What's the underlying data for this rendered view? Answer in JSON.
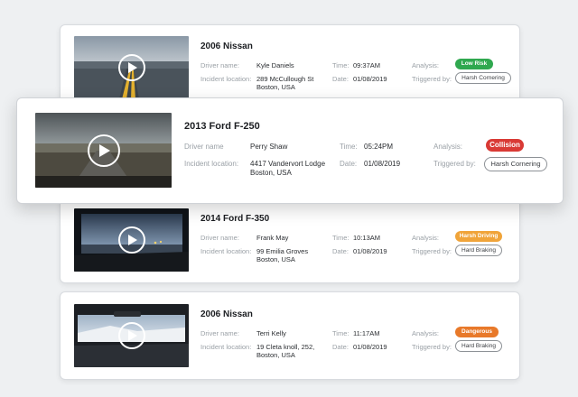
{
  "labels": {
    "driver": "Driver name:",
    "driver_featured": "Driver name",
    "location": "Incident location:",
    "time": "Time:",
    "date": "Date:",
    "analysis": "Analysis:",
    "triggered": "Triggered by:"
  },
  "incidents": [
    {
      "vehicle": "2006 Nissan",
      "driver": "Kyle Daniels",
      "location": "289 McCullough St Boston, USA",
      "time": "09:37AM",
      "date": "01/08/2019",
      "analysis": "Low Risk",
      "analysis_color": "#2fa84f",
      "trigger": "Harsh Cornering"
    },
    {
      "vehicle": "2013 Ford F-250",
      "driver": "Perry Shaw",
      "location": "4417 Vandervort Lodge Boston, USA",
      "time": "05:24PM",
      "date": "01/08/2019",
      "analysis": "Collision",
      "analysis_color": "#d93a35",
      "trigger": "Harsh Cornering"
    },
    {
      "vehicle": "2014 Ford F-350",
      "driver": "Frank May",
      "location": "99 Emilia Groves Boston, USA",
      "time": "10:13AM",
      "date": "01/08/2019",
      "analysis": "Harsh Driving",
      "analysis_color": "#f0a43a",
      "trigger": "Hard Braking"
    },
    {
      "vehicle": "2006 Nissan",
      "driver": "Terri Kelly",
      "location": "19 Cleta knoll, 252, Boston, USA",
      "time": "11:17AM",
      "date": "01/08/2019",
      "analysis": "Dangerous",
      "analysis_color": "#e8792a",
      "trigger": "Hard Braking"
    }
  ]
}
